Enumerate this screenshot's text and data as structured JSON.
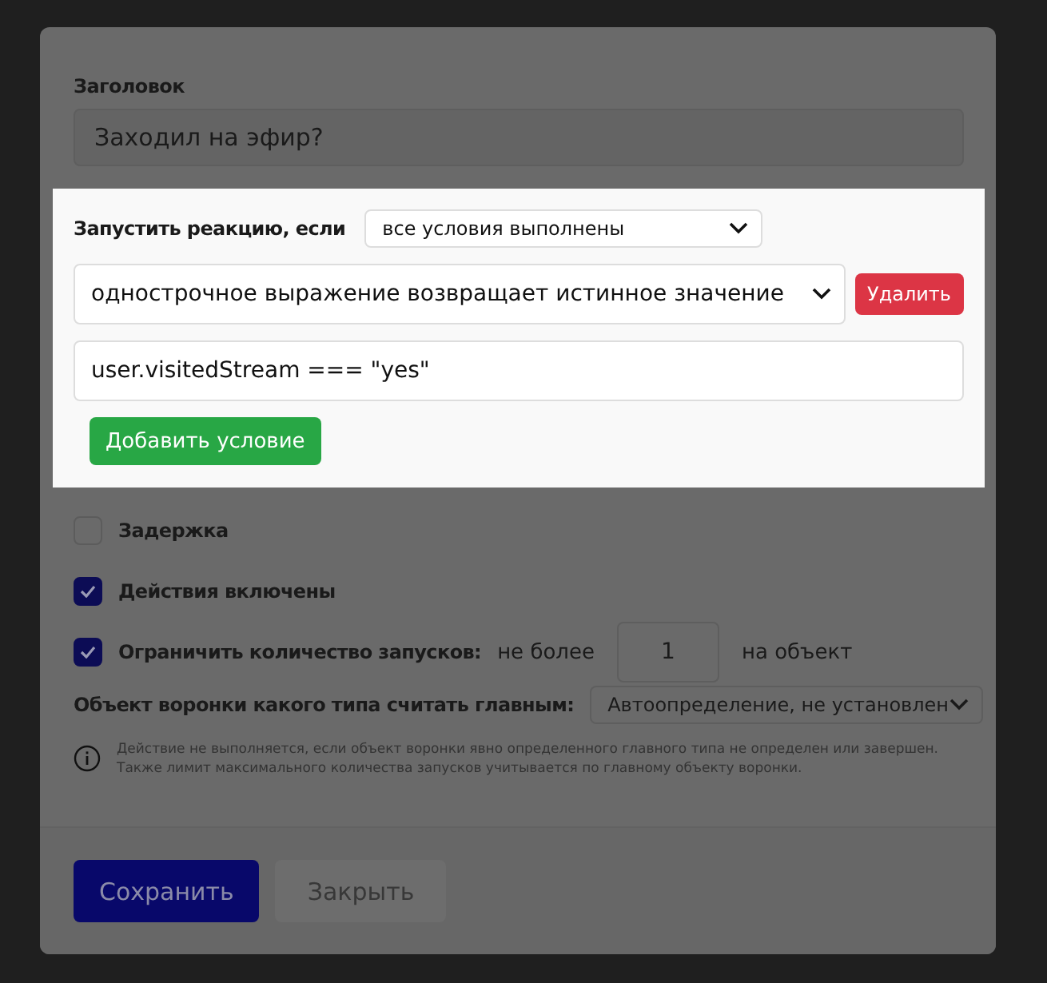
{
  "title_field": {
    "label": "Заголовок",
    "value": "Заходил на эфир?"
  },
  "conditions_panel": {
    "label": "Запустить реакцию, если",
    "mode": "все условия выполнены",
    "conditions": [
      {
        "type": "однострочное выражение возвращает истинное значение",
        "delete_label": "Удалить",
        "expression": "user.visitedStream === \"yes\""
      }
    ],
    "add_label": "Добавить условие"
  },
  "options": [
    {
      "kind": "checkbox",
      "label": "Задержка",
      "checked": false
    },
    {
      "kind": "checkbox",
      "label": "Действия включены",
      "checked": true
    },
    {
      "kind": "limit",
      "label": "Ограничить количество запусков:",
      "checked": true,
      "prefix": "не более",
      "value": "1",
      "suffix": "на объект"
    }
  ],
  "funnel": {
    "label": "Объект воронки какого типа считать главным:",
    "value": "Автоопределение, не установлен"
  },
  "note": [
    "Действие не выполняется, если объект воронки явно определенного главного типа не определен или завершен.",
    "Также лимит максимального количества запусков учитывается по главному объекту воронки."
  ],
  "footer_buttons": [
    {
      "kind": "primary",
      "label": "Сохранить"
    },
    {
      "kind": "secondary",
      "label": "Закрыть"
    }
  ]
}
